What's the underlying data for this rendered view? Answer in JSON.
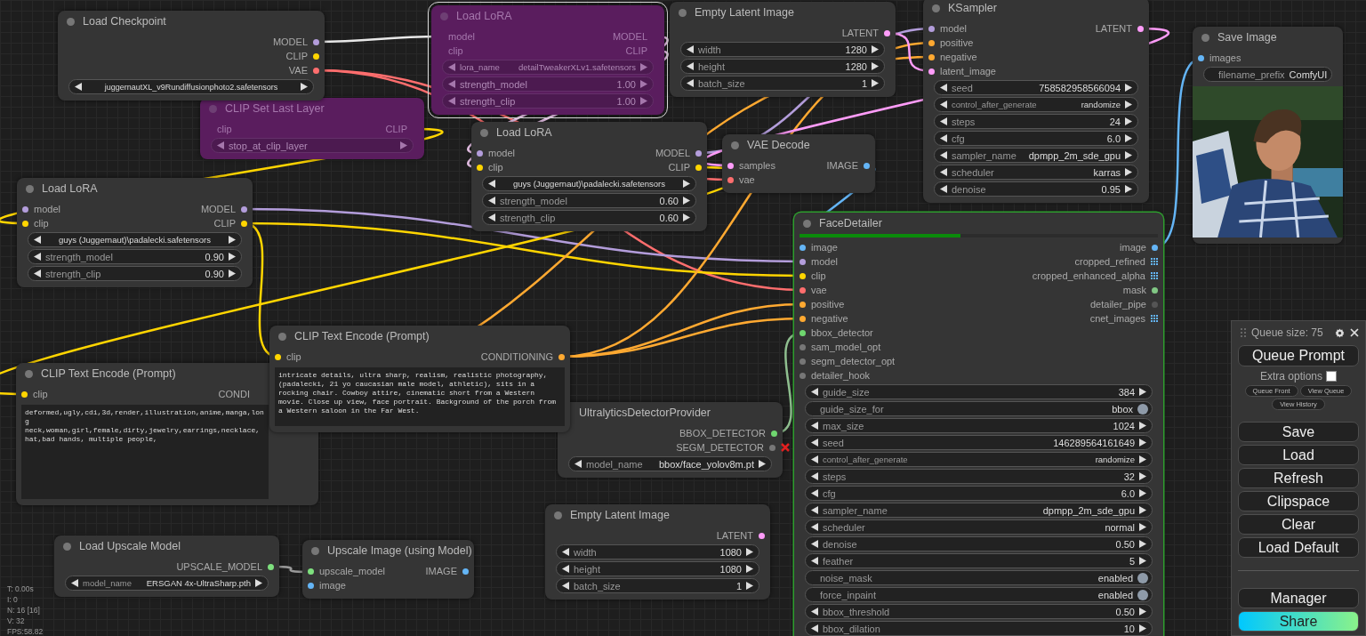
{
  "nodes": [
    {
      "title": "Load Checkpoint",
      "bypassed": false,
      "selected": false,
      "running": false,
      "outputs": [
        {
          "name": "MODEL",
          "color": "#b39ddb"
        },
        {
          "name": "CLIP",
          "color": "#ffd500"
        },
        {
          "name": "VAE",
          "color": "#ff6e6e"
        }
      ],
      "widgets": [
        {
          "kind": "stepper",
          "value": "juggernautXL_v9Rundiffusionphoto2.safetensors"
        }
      ]
    },
    {
      "title": "Load LoRA",
      "bypassed": true,
      "selected": true,
      "running": false,
      "inputs": [
        {
          "name": "model"
        },
        {
          "name": "clip"
        }
      ],
      "outputs": [
        {
          "name": "MODEL"
        },
        {
          "name": "CLIP"
        }
      ],
      "widgets": [
        {
          "kind": "stepper",
          "label": "lora_name",
          "value": "detailTweakerXLv1.safetensors"
        },
        {
          "kind": "stepper",
          "label": "strength_model",
          "value": "1.00"
        },
        {
          "kind": "stepper",
          "label": "strength_clip",
          "value": "1.00"
        }
      ]
    },
    {
      "title": "Empty Latent Image",
      "bypassed": false,
      "selected": false,
      "running": false,
      "outputs": [
        {
          "name": "LATENT",
          "color": "#ff9cf9"
        }
      ],
      "widgets": [
        {
          "kind": "stepper",
          "label": "width",
          "value": "1280"
        },
        {
          "kind": "stepper",
          "label": "height",
          "value": "1280"
        },
        {
          "kind": "stepper",
          "label": "batch_size",
          "value": "1"
        }
      ]
    },
    {
      "title": "KSampler",
      "bypassed": false,
      "selected": false,
      "running": false,
      "inputs": [
        {
          "name": "model",
          "color": "#b39ddb"
        },
        {
          "name": "positive",
          "color": "#ffa931"
        },
        {
          "name": "negative",
          "color": "#ffa931"
        },
        {
          "name": "latent_image",
          "color": "#ff9cf9"
        }
      ],
      "outputs": [
        {
          "name": "LATENT",
          "color": "#ff9cf9"
        }
      ],
      "widgets": [
        {
          "kind": "stepper",
          "label": "seed",
          "value": "758582958566094"
        },
        {
          "kind": "stepper",
          "label": "control_after_generate",
          "value": "randomize"
        },
        {
          "kind": "stepper",
          "label": "steps",
          "value": "24"
        },
        {
          "kind": "stepper",
          "label": "cfg",
          "value": "6.0"
        },
        {
          "kind": "stepper",
          "label": "sampler_name",
          "value": "dpmpp_2m_sde_gpu"
        },
        {
          "kind": "stepper",
          "label": "scheduler",
          "value": "karras"
        },
        {
          "kind": "stepper",
          "label": "denoise",
          "value": "0.95"
        }
      ]
    },
    {
      "title": "Save Image",
      "bypassed": false,
      "selected": false,
      "running": false,
      "inputs": [
        {
          "name": "images",
          "color": "#64b5f6"
        }
      ],
      "widgets": [
        {
          "kind": "text",
          "label": "filename_prefix",
          "value": "ComfyUI"
        }
      ],
      "preview": {
        "kind": "picture"
      }
    },
    {
      "title": "CLIP Set Last Layer",
      "bypassed": true,
      "selected": false,
      "running": false,
      "inputs": [
        {
          "name": "clip"
        }
      ],
      "outputs": [
        {
          "name": "CLIP"
        }
      ],
      "widgets": [
        {
          "kind": "stepper",
          "label": "stop_at_clip_layer"
        }
      ]
    },
    {
      "title": "Load LoRA",
      "bypassed": false,
      "selected": false,
      "running": false,
      "inputs": [
        {
          "name": "model",
          "color": "#b39ddb"
        },
        {
          "name": "clip",
          "color": "#ffd500"
        }
      ],
      "outputs": [
        {
          "name": "MODEL",
          "color": "#b39ddb"
        },
        {
          "name": "CLIP",
          "color": "#ffd500"
        }
      ],
      "widgets": [
        {
          "kind": "stepper",
          "value": "guys (Juggernaut)\\padalecki.safetensors"
        },
        {
          "kind": "stepper",
          "label": "strength_model",
          "value": "0.60"
        },
        {
          "kind": "stepper",
          "label": "strength_clip",
          "value": "0.60"
        }
      ]
    },
    {
      "title": "VAE Decode",
      "bypassed": false,
      "selected": false,
      "running": false,
      "inputs": [
        {
          "name": "samples",
          "color": "#ff9cf9"
        },
        {
          "name": "vae",
          "color": "#ff6e6e"
        }
      ],
      "outputs": [
        {
          "name": "IMAGE",
          "color": "#64b5f6"
        }
      ]
    },
    {
      "title": "Load LoRA",
      "bypassed": false,
      "selected": false,
      "running": false,
      "inputs": [
        {
          "name": "model",
          "color": "#b39ddb"
        },
        {
          "name": "clip",
          "color": "#ffd500"
        }
      ],
      "outputs": [
        {
          "name": "MODEL",
          "color": "#b39ddb"
        },
        {
          "name": "CLIP",
          "color": "#ffd500"
        }
      ],
      "widgets": [
        {
          "kind": "stepper",
          "value": "guys (Juggernaut)\\padalecki.safetensors"
        },
        {
          "kind": "stepper",
          "label": "strength_model",
          "value": "0.90"
        },
        {
          "kind": "stepper",
          "label": "strength_clip",
          "value": "0.90"
        }
      ]
    },
    {
      "title": "FaceDetailer",
      "bypassed": false,
      "selected": false,
      "running": true,
      "progress": {
        "level": 0.45
      },
      "inputs": [
        {
          "name": "image",
          "color": "#64b5f6"
        },
        {
          "name": "model",
          "color": "#b39ddb"
        },
        {
          "name": "clip",
          "color": "#ffd500"
        },
        {
          "name": "vae",
          "color": "#ff6e6e"
        },
        {
          "name": "positive",
          "color": "#ffa931"
        },
        {
          "name": "negative",
          "color": "#ffa931"
        },
        {
          "name": "bbox_detector",
          "color": "#6fd66f"
        },
        {
          "name": "sam_model_opt",
          "color": "#777777"
        },
        {
          "name": "segm_detector_opt",
          "color": "#777777"
        },
        {
          "name": "detailer_hook",
          "color": "#777777"
        }
      ],
      "outputs": [
        {
          "name": "image",
          "color": "#64b5f6",
          "kind": "dot"
        },
        {
          "name": "cropped_refined",
          "color": "#64b5f6",
          "kind": "grid"
        },
        {
          "name": "cropped_enhanced_alpha",
          "color": "#64b5f6",
          "kind": "grid"
        },
        {
          "name": "mask",
          "color": "#81c784",
          "kind": "dot"
        },
        {
          "name": "detailer_pipe",
          "color": "#555555",
          "kind": "dot"
        },
        {
          "name": "cnet_images",
          "color": "#64b5f6",
          "kind": "grid"
        }
      ],
      "widgets": [
        {
          "kind": "stepper",
          "label": "guide_size",
          "value": "384"
        },
        {
          "kind": "toggle",
          "label": "guide_size_for",
          "value": "bbox",
          "on": true
        },
        {
          "kind": "stepper",
          "label": "max_size",
          "value": "1024"
        },
        {
          "kind": "stepper",
          "label": "seed",
          "value": "146289564161649"
        },
        {
          "kind": "stepper",
          "label": "control_after_generate",
          "value": "randomize"
        },
        {
          "kind": "stepper",
          "label": "steps",
          "value": "32"
        },
        {
          "kind": "stepper",
          "label": "cfg",
          "value": "6.0"
        },
        {
          "kind": "stepper",
          "label": "sampler_name",
          "value": "dpmpp_2m_sde_gpu"
        },
        {
          "kind": "stepper",
          "label": "scheduler",
          "value": "normal"
        },
        {
          "kind": "stepper",
          "label": "denoise",
          "value": "0.50"
        },
        {
          "kind": "stepper",
          "label": "feather",
          "value": "5"
        },
        {
          "kind": "toggle",
          "label": "noise_mask",
          "value": "enabled",
          "on": true
        },
        {
          "kind": "toggle",
          "label": "force_inpaint",
          "value": "enabled",
          "on": true
        },
        {
          "kind": "stepper",
          "label": "bbox_threshold",
          "value": "0.50"
        },
        {
          "kind": "stepper",
          "label": "bbox_dilation",
          "value": "10"
        }
      ]
    },
    {
      "title": "CLIP Text Encode (Prompt)",
      "bypassed": false,
      "selected": false,
      "running": false,
      "inputs": [
        {
          "name": "clip",
          "color": "#ffd500"
        }
      ],
      "outputs": [
        {
          "name": "CONDI"
        }
      ],
      "widgets": [
        {
          "kind": "textarea",
          "value": "deformed,ugly,cdi,3d,render,illustration,anime,manga,long neck,woman,girl,female,dirty,jewelry,earrings,necklace, hat,bad hands, multiple people,"
        }
      ]
    },
    {
      "title": "CLIP Text Encode (Prompt)",
      "bypassed": false,
      "selected": false,
      "running": false,
      "inputs": [
        {
          "name": "clip",
          "color": "#ffd500"
        }
      ],
      "outputs": [
        {
          "name": "CONDITIONING",
          "color": "#ffa931"
        }
      ],
      "widgets": [
        {
          "kind": "textarea",
          "value": "intricate details, ultra sharp, realism, realistic photography, (padalecki, 21 yo caucasian male model, athletic), sits in a rocking chair. Cowboy attire, cinematic short from a Western movie. Close up view, face portrait. Background of the porch from a Western saloon in the Far West."
        }
      ]
    },
    {
      "title": "UltralyticsDetectorProvider",
      "bypassed": false,
      "selected": false,
      "running": false,
      "outputs": [
        {
          "name": "BBOX_DETECTOR",
          "color": "#6fd66f",
          "broken": false
        },
        {
          "name": "SEGM_DETECTOR",
          "color": "#777777",
          "broken": true
        }
      ],
      "widgets": [
        {
          "kind": "stepper",
          "label": "model_name",
          "value": "bbox/face_yolov8m.pt"
        }
      ]
    },
    {
      "title": "Load Upscale Model",
      "bypassed": false,
      "selected": false,
      "running": false,
      "outputs": [
        {
          "name": "UPSCALE_MODEL",
          "color": "#7ee07e"
        }
      ],
      "widgets": [
        {
          "kind": "stepper",
          "label": "model_name",
          "value": "ERSGAN 4x-UltraSharp.pth"
        }
      ]
    },
    {
      "title": "Upscale Image (using Model)",
      "bypassed": false,
      "selected": false,
      "running": false,
      "inputs": [
        {
          "name": "upscale_model",
          "color": "#7ee07e"
        },
        {
          "name": "image",
          "color": "#64b5f6"
        }
      ],
      "outputs": [
        {
          "name": "IMAGE",
          "color": "#64b5f6"
        }
      ]
    },
    {
      "title": "Empty Latent Image",
      "bypassed": false,
      "selected": false,
      "running": false,
      "outputs": [
        {
          "name": "LATENT",
          "color": "#ff9cf9"
        }
      ],
      "widgets": [
        {
          "kind": "stepper",
          "label": "width",
          "value": "1080"
        },
        {
          "kind": "stepper",
          "label": "height",
          "value": "1080"
        },
        {
          "kind": "stepper",
          "label": "batch_size",
          "value": "1"
        }
      ]
    }
  ],
  "stats": [
    "T: 0.00s",
    "I: 0",
    "N: 16 [16]",
    "V: 32",
    "FPS:58.82"
  ],
  "queue_panel": {
    "title": "Queue size: 75",
    "queue_button": "Queue Prompt",
    "extra_options": {
      "label": "Extra options",
      "checked": false
    },
    "small_buttons": [
      "Queue Front",
      "View Queue",
      "View History"
    ],
    "buttons": [
      "Save",
      "Load",
      "Refresh",
      "Clipspace",
      "Clear",
      "Load Default"
    ],
    "footer_buttons": [
      {
        "label": "Manager",
        "kind": "plain"
      },
      {
        "label": "Share",
        "kind": "gradient"
      }
    ]
  }
}
